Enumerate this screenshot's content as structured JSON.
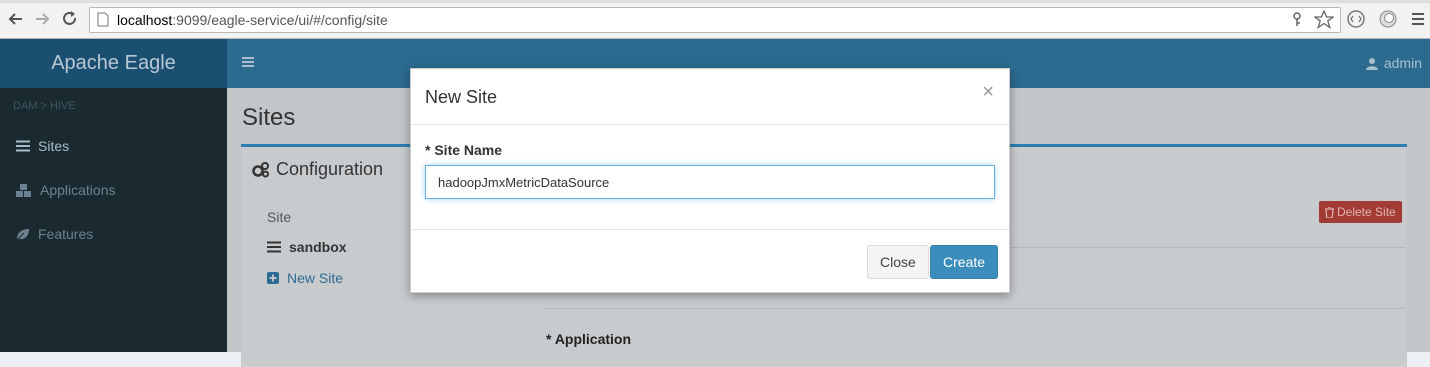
{
  "browser": {
    "url_host": "localhost",
    "url_rest": ":9099/eagle-service/ui/#/config/site"
  },
  "header": {
    "logo": "Apache Eagle",
    "user": "admin"
  },
  "sidebar": {
    "breadcrumb": "DAM > HIVE",
    "items": [
      {
        "label": "Sites",
        "icon": "list-icon"
      },
      {
        "label": "Applications",
        "icon": "cubes-icon"
      },
      {
        "label": "Features",
        "icon": "leaf-icon"
      }
    ]
  },
  "content": {
    "title": "Sites",
    "box_title": "Configuration",
    "col_header": "Site",
    "site": "sandbox",
    "new_site": "New Site",
    "delete_button": "Delete Site",
    "application_label": "* Application"
  },
  "modal": {
    "title": "New Site",
    "close_symbol": "×",
    "field_label": "* Site Name",
    "field_value": "hadoopJmxMetricDataSource",
    "close_button": "Close",
    "create_button": "Create"
  },
  "colors": {
    "primary": "#3c8dbc",
    "danger": "#a13b34",
    "header": "#2c6b8f",
    "sidebar": "#1b2a31"
  }
}
